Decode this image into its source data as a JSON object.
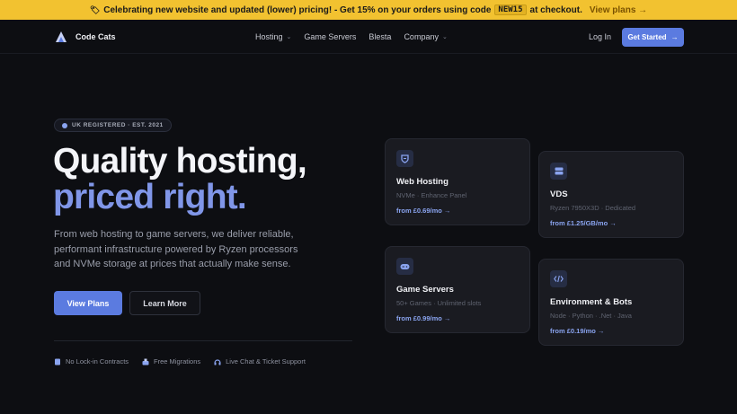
{
  "promo": {
    "emoji": "🏷",
    "text_before": "Celebrating new website and updated (lower) pricing! - Get 15% on your orders using code",
    "code": "NEW15",
    "text_after": "at checkout.",
    "link": "View plans →"
  },
  "nav": {
    "brand": "Code Cats",
    "menu": [
      {
        "label": "Hosting",
        "chevron": "⌄"
      },
      {
        "label": "Game Servers",
        "chevron": ""
      },
      {
        "label": "Blesta",
        "chevron": ""
      },
      {
        "label": "Company",
        "chevron": "⌄"
      }
    ],
    "login": "Log In",
    "cta": "Get Started",
    "cta_arrow": "→"
  },
  "hero": {
    "badge": "UK REGISTERED · EST. 2021",
    "headline_1": "Quality hosting,",
    "headline_2": "priced right.",
    "subtitle": "From web hosting to game servers, we deliver reliable, performant infrastructure powered by Ryzen processors and NVMe storage at prices that actually make sense.",
    "primary_button": "View Plans",
    "secondary_button": "Learn More",
    "features": [
      {
        "icon": "file-icon",
        "label": "No Lock-in Contracts"
      },
      {
        "icon": "migrate-icon",
        "label": "Free Migrations"
      },
      {
        "icon": "headset-icon",
        "label": "Live Chat & Ticket Support"
      }
    ]
  },
  "cards": [
    {
      "title": "Web Hosting",
      "desc": "NVMe · Enhance Panel",
      "price": "from £0.69/mo →",
      "icon": "shield-icon"
    },
    {
      "title": "VDS",
      "desc": "Ryzen 7950X3D · Dedicated",
      "price": "from £1.25/GB/mo →",
      "icon": "server-icon"
    },
    {
      "title": "Game Servers",
      "desc": "50+ Games · Unlimited slots",
      "price": "from £0.99/mo →",
      "icon": "gamepad-icon"
    },
    {
      "title": "Environment & Bots",
      "desc": "Node · Python · .Net · Java",
      "price": "from £0.19/mo →",
      "icon": "code-icon"
    }
  ],
  "colors": {
    "accent": "#5b7be0",
    "promo_bg": "#f2c230",
    "background": "#0d0e12"
  }
}
